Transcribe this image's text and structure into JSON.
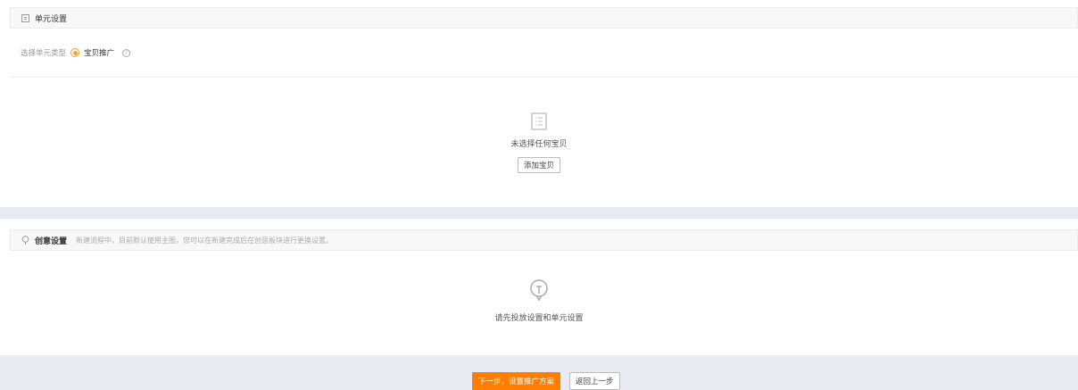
{
  "unit": {
    "title": "单元设置",
    "type_label": "选择单元类型",
    "type_option": "宝贝推广",
    "help": "?",
    "empty_text": "未选择任何宝贝",
    "add_button": "添加宝贝"
  },
  "creative": {
    "title": "创意设置",
    "note": "新建流程中，目前默认使用主图，您可以在新建完成后在创意板块进行更换设置。",
    "empty_text": "请先投放设置和单元设置"
  },
  "footer": {
    "next_button": "下一步，设置推广方案",
    "back_button": "返回上一步"
  },
  "colors": {
    "accent": "#ff7d00",
    "radio": "#f7a12a"
  }
}
